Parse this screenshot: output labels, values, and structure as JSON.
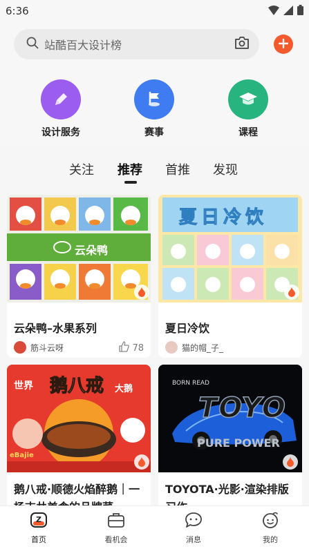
{
  "status": {
    "time": "6:36"
  },
  "search": {
    "placeholder": "站酷百大设计榜"
  },
  "categories": [
    {
      "label": "设计服务",
      "icon": "pen-icon",
      "color": "#9b5cf0"
    },
    {
      "label": "赛事",
      "icon": "flag-icon",
      "color": "#3f7cf2"
    },
    {
      "label": "课程",
      "icon": "graduation-cap-icon",
      "color": "#27b47e"
    }
  ],
  "tabs": [
    {
      "label": "关注"
    },
    {
      "label": "推荐",
      "active": true
    },
    {
      "label": "首推"
    },
    {
      "label": "发现"
    }
  ],
  "cards": [
    {
      "title": "云朵鸭–水果系列",
      "author": "筋斗云呀",
      "likes": "78",
      "image_text": "云朵鸭"
    },
    {
      "title": "夏日冷饮",
      "author": "猫的帽_子_",
      "image_text": "夏日冷饮"
    },
    {
      "title": "鹅八戒·顺德火焰醉鹅｜一杨吉共美食的品牌菜",
      "image_text_main": "鹅八戒",
      "image_text_left": "世界",
      "image_text_right": "大鹅",
      "image_text_sub": "eBajie"
    },
    {
      "title": "TOYOTA·光影·渲染排版习作",
      "image_text_top": "BORN READ",
      "image_text_main": "TOYO",
      "image_text_sub": "PURE POWER"
    }
  ],
  "bottom_nav": [
    {
      "label": "首页",
      "icon": "home-icon"
    },
    {
      "label": "看机会",
      "icon": "briefcase-icon"
    },
    {
      "label": "消息",
      "icon": "message-icon"
    },
    {
      "label": "我的",
      "icon": "profile-icon"
    }
  ],
  "colors": {
    "accent": "#f45a2b"
  }
}
